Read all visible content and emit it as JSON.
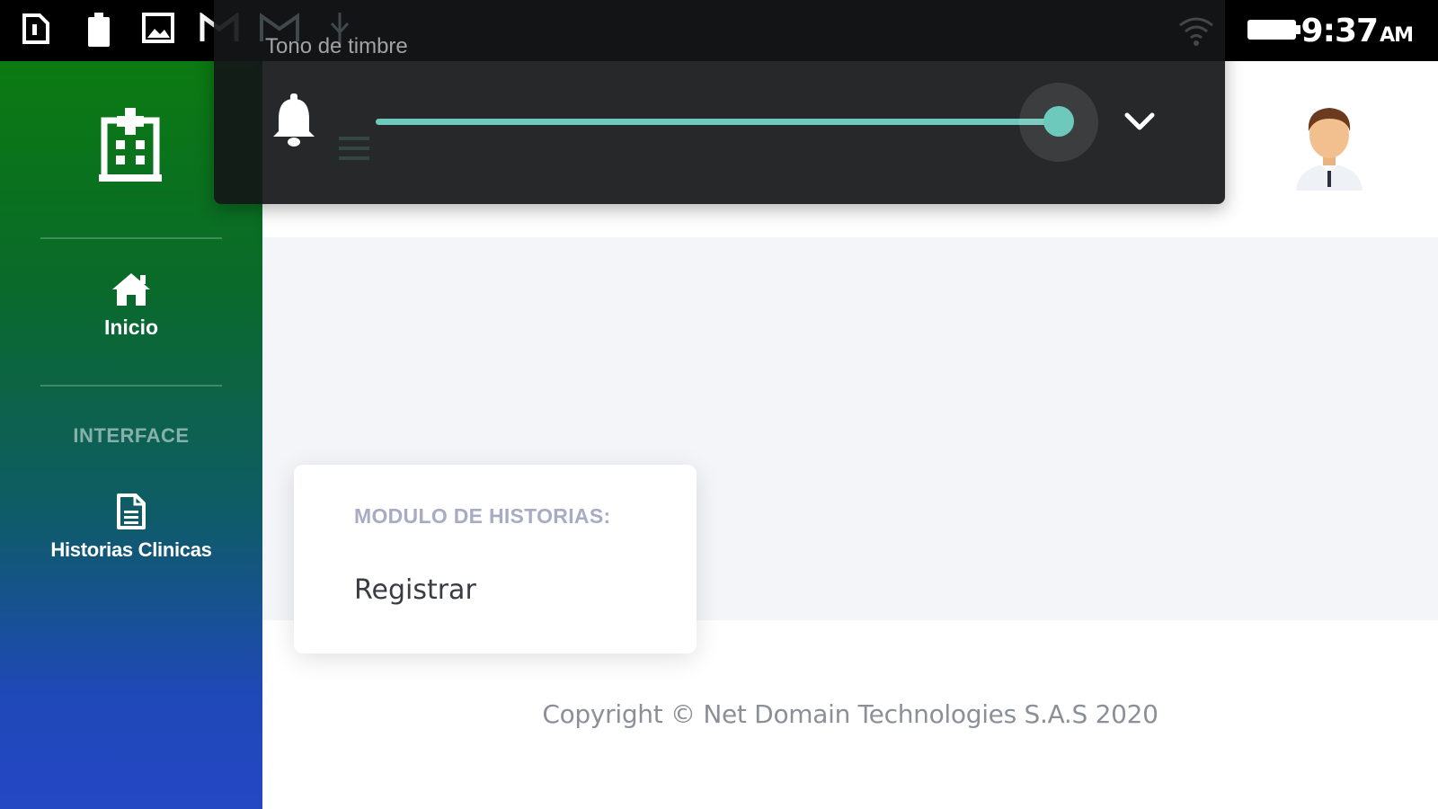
{
  "status_bar": {
    "time": "9:37",
    "ampm": "AM",
    "icons": [
      "sim-card-icon",
      "battery-saver-icon",
      "image-icon",
      "gmail-icon",
      "gmail-icon",
      "usb-icon",
      "wifi-icon",
      "battery-icon"
    ]
  },
  "volume_panel": {
    "title": "Tono de timbre",
    "level": 1.0,
    "accent_color": "#6ec9bd"
  },
  "sidebar": {
    "brand_icon": "hospital-icon",
    "items": [
      {
        "label": "Inicio",
        "icon": "home-icon"
      },
      {
        "label": "Historias Clinicas",
        "icon": "file-icon"
      }
    ],
    "section_heading": "INTERFACE",
    "colors": {
      "top": "#0b7a12",
      "bottom": "#2447c4"
    }
  },
  "card": {
    "heading": "MODULO DE HISTORIAS:",
    "link": "Registrar"
  },
  "footer": {
    "copyright": "Copyright © Net Domain Technologies S.A.S 2020"
  }
}
